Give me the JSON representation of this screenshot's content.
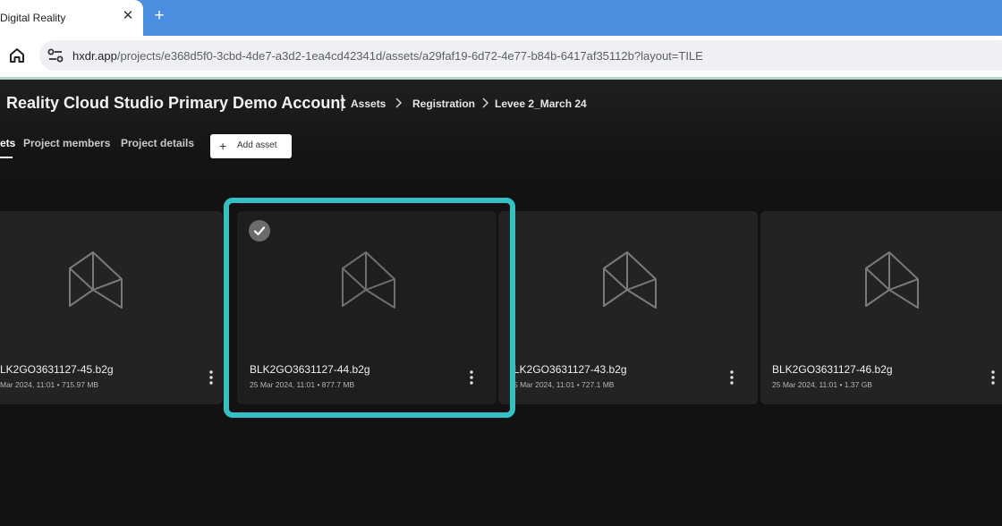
{
  "browser": {
    "tab_title": "Digital Reality",
    "tab_close": "✕",
    "new_tab": "+",
    "url_host": "hxdr.app",
    "url_path": "/projects/e368d5f0-3cbd-4de7-a3d2-1ea4cd42341d/assets/a29faf19-6d72-4e77-b84b-6417af35112b?layout=TILE"
  },
  "header": {
    "project_title": "Reality Cloud Studio Primary Demo Account",
    "separator": "|",
    "breadcrumb": [
      "Assets",
      "Registration",
      "Levee 2_March 24"
    ]
  },
  "nav": {
    "tabs": [
      "ets",
      "Project members",
      "Project details"
    ],
    "add_asset_icon": "+",
    "add_asset_label": "Add asset"
  },
  "assets": [
    {
      "name": "LK2GO3631127-45.b2g",
      "meta": "Mar 2024, 11:01 • 715.97 MB",
      "selected": false
    },
    {
      "name": "BLK2GO3631127-44.b2g",
      "meta": "25 Mar 2024, 11:01 • 877.7 MB",
      "selected": true
    },
    {
      "name": "LK2GO3631127-43.b2g",
      "meta": "5 Mar 2024, 11:01 • 727.1 MB",
      "selected": false
    },
    {
      "name": "BLK2GO3631127-46.b2g",
      "meta": "25 Mar 2024, 11:01 • 1.37 GB",
      "selected": false
    }
  ],
  "colors": {
    "browser_tabbar": "#4a8fe0",
    "highlight": "#37bfc6",
    "tile_background": "#232323",
    "app_background": "#121212"
  },
  "icons": {
    "home": "home-icon",
    "site_info": "tune-icon",
    "chevron": "chevron-right-icon",
    "asset_placeholder": "hxdr-logo-icon",
    "more": "more-vertical-icon",
    "selected": "check-circle-icon"
  }
}
